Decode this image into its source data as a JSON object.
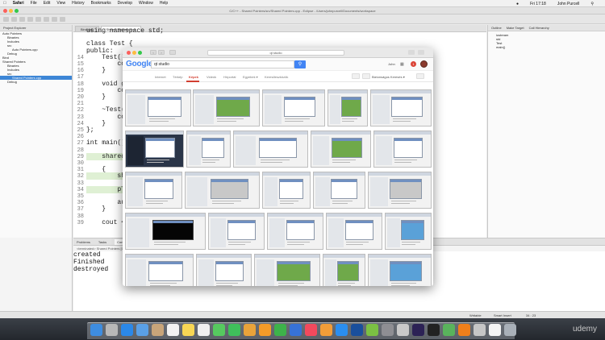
{
  "menubar": {
    "app": "Safari",
    "items": [
      "File",
      "Edit",
      "View",
      "History",
      "Bookmarks",
      "Develop",
      "Window",
      "Help"
    ],
    "clock": "Fri 17:18",
    "user": "John Purcell"
  },
  "eclipse": {
    "window_title": "C/C++ - Shared Pointers/src/Shared Pointers.cpp - Eclipse - /Users/johnpurcell/Documents/workspace",
    "project_explorer_title": "Project Explorer",
    "tree": [
      "Auto Pointers",
      "Binaries",
      "Includes",
      "src",
      "Auto Pointers.cpp",
      "Debug",
      "Bind",
      "Shared Pointers",
      "Binaries",
      "Includes",
      "src",
      "Shared Pointers.cpp",
      "Debug"
    ],
    "editor_tabs": [
      "Bind.cpp",
      "Shared Pointers.cpp"
    ],
    "code_lines": [
      {
        "ln": "",
        "text": "using namespace std;"
      },
      {
        "ln": "",
        "text": ""
      },
      {
        "ln": "",
        "text": "class Test {"
      },
      {
        "ln": "",
        "text": "public:"
      },
      {
        "ln": "14",
        "text": "    Test() {"
      },
      {
        "ln": "15",
        "text": "        cout"
      },
      {
        "ln": "16",
        "text": "    }"
      },
      {
        "ln": "17",
        "text": ""
      },
      {
        "ln": "18",
        "text": "    void gre"
      },
      {
        "ln": "19",
        "text": "        cout"
      },
      {
        "ln": "20",
        "text": "    }"
      },
      {
        "ln": "21",
        "text": ""
      },
      {
        "ln": "22",
        "text": "    ~Test()"
      },
      {
        "ln": "23",
        "text": "        cout"
      },
      {
        "ln": "24",
        "text": "    }"
      },
      {
        "ln": "25",
        "text": "};"
      },
      {
        "ln": "26",
        "text": ""
      },
      {
        "ln": "27",
        "text": "int main() {"
      },
      {
        "ln": "28",
        "text": ""
      },
      {
        "ln": "29",
        "text": "    shared_p"
      },
      {
        "ln": "30",
        "text": ""
      },
      {
        "ln": "31",
        "text": "    {"
      },
      {
        "ln": "32",
        "text": "        shar"
      },
      {
        "ln": "33",
        "text": ""
      },
      {
        "ln": "34",
        "text": "        pTes"
      },
      {
        "ln": "35",
        "text": ""
      },
      {
        "ln": "36",
        "text": "        auto"
      },
      {
        "ln": "37",
        "text": "    }"
      },
      {
        "ln": "38",
        "text": ""
      },
      {
        "ln": "39",
        "text": "    cout <<"
      }
    ],
    "outline_title": "Outline",
    "outline_tabs": [
      "Make Target",
      "Call Hierarchy"
    ],
    "outline_items": [
      "iostream",
      "std",
      "Test",
      "main()"
    ],
    "console_tabs": [
      "Problems",
      "Tasks",
      "Console",
      "Properties"
    ],
    "console_header": "<terminated> Shared Pointers [C/C++ Application] /Users/johnpurcell/Documents/workspace/Shared Pointers/Debug/Shared Pointers",
    "console_lines": [
      "created",
      "Finished",
      "destroyed"
    ],
    "status": {
      "mode": "Writable",
      "insert": "Smart Insert",
      "position": "34 : 23"
    }
  },
  "safari": {
    "address": "qt studio",
    "google": {
      "logo": "Google",
      "query": "qt studio",
      "user": "John",
      "notifications": "1",
      "tabs": [
        "Internet",
        "Térkép",
        "Képek",
        "Videók",
        "Hírportál",
        "Egyebek ▾",
        "Keresőeszközök"
      ],
      "active_tab": "Képek",
      "safe_search": "Biztonságos Keresés ▾"
    }
  },
  "dock": {
    "watermark": "udemy"
  },
  "colors": {
    "google_blue": "#4285f4",
    "google_red": "#d23f31",
    "selection": "#3d86d6"
  }
}
